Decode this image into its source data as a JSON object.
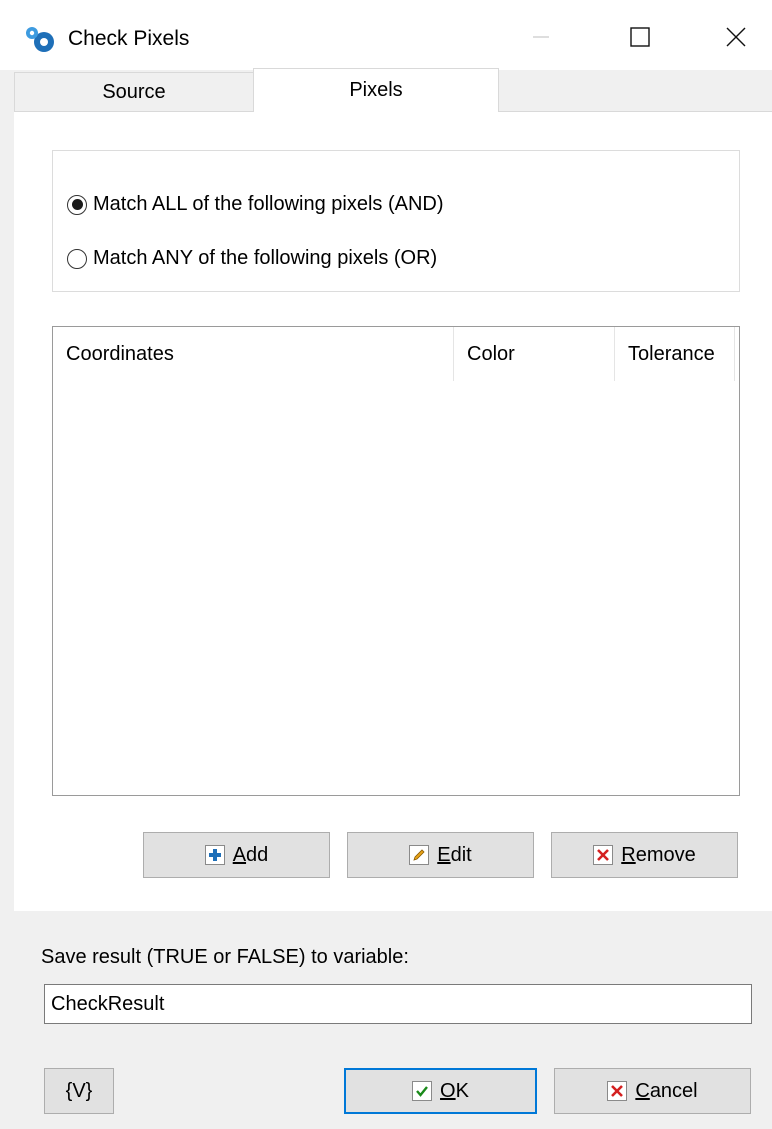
{
  "window": {
    "title": "Check Pixels",
    "accent": "#0078d7"
  },
  "tabs": [
    {
      "label": "Source",
      "active": false
    },
    {
      "label": "Pixels",
      "active": true
    }
  ],
  "match_mode": {
    "options": [
      {
        "label": "Match ALL of the following pixels (AND)",
        "selected": true
      },
      {
        "label": "Match ANY of the following pixels (OR)",
        "selected": false
      }
    ]
  },
  "pixel_list": {
    "columns": [
      "Coordinates",
      "Color",
      "Tolerance"
    ],
    "rows": []
  },
  "actions": {
    "add_prefix": "",
    "add_key": "A",
    "add_rest": "dd",
    "edit_key": "E",
    "edit_rest": "dit",
    "remove_key": "R",
    "remove_rest": "emove"
  },
  "result": {
    "label": "Save result (TRUE or FALSE) to variable:",
    "value": "CheckResult"
  },
  "footer": {
    "variable_button": "{V}",
    "ok_key": "O",
    "ok_rest": "K",
    "cancel_key": "C",
    "cancel_rest": "ancel"
  },
  "icons": {
    "app": "gears-icon",
    "add": "plus-icon",
    "edit": "pencil-icon",
    "remove": "x-icon",
    "ok": "checkmark-icon",
    "cancel": "x-icon"
  }
}
